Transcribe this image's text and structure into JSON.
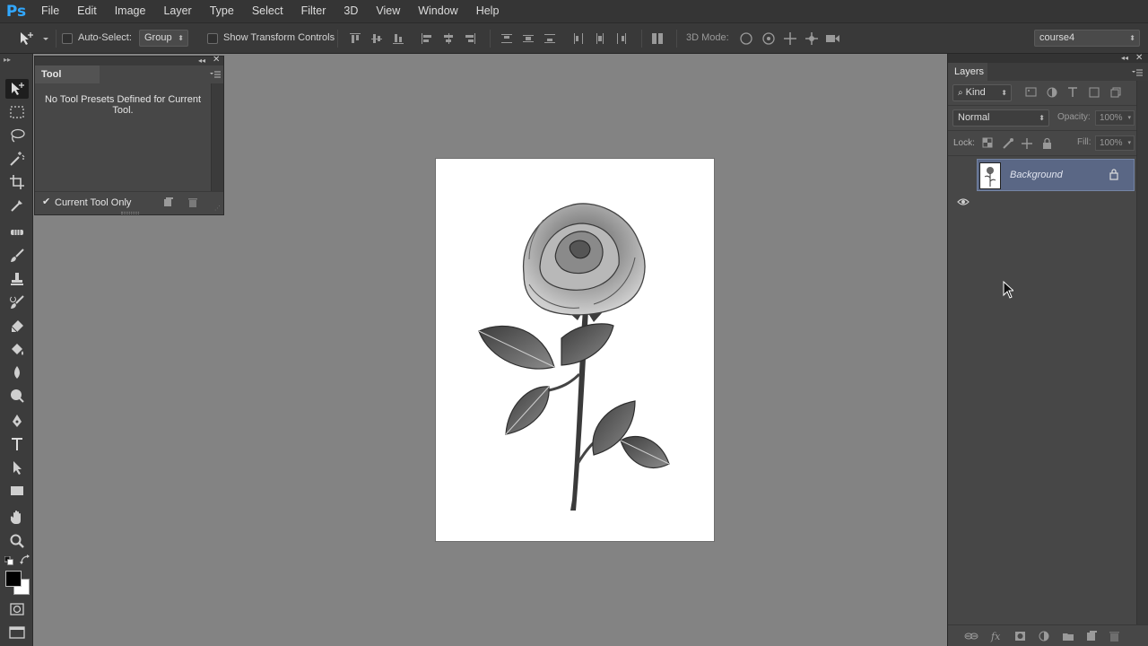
{
  "app": {
    "logo": "Ps"
  },
  "menu": [
    "File",
    "Edit",
    "Image",
    "Layer",
    "Type",
    "Select",
    "Filter",
    "3D",
    "View",
    "Window",
    "Help"
  ],
  "options_bar": {
    "auto_select_label": "Auto-Select:",
    "auto_select_value": "Group",
    "transform_label": "Show Transform Controls",
    "mode_label": "3D Mode:",
    "workspace": "course4"
  },
  "tool_presets": {
    "title": "Tool Presets",
    "message": "No Tool Presets Defined for Current Tool.",
    "current_only_label": "Current Tool Only",
    "current_only_checked": true
  },
  "layers": {
    "title": "Layers",
    "filter_kind": "Kind",
    "blend_mode": "Normal",
    "opacity_label": "Opacity:",
    "opacity_value": "100%",
    "lock_label": "Lock:",
    "fill_label": "Fill:",
    "fill_value": "100%",
    "items": [
      {
        "name": "Background",
        "visible": true,
        "locked": true
      }
    ]
  },
  "colors": {
    "foreground": "#000000",
    "background": "#ffffff",
    "accent": "#31a8ff",
    "selection": "#5a6785"
  }
}
